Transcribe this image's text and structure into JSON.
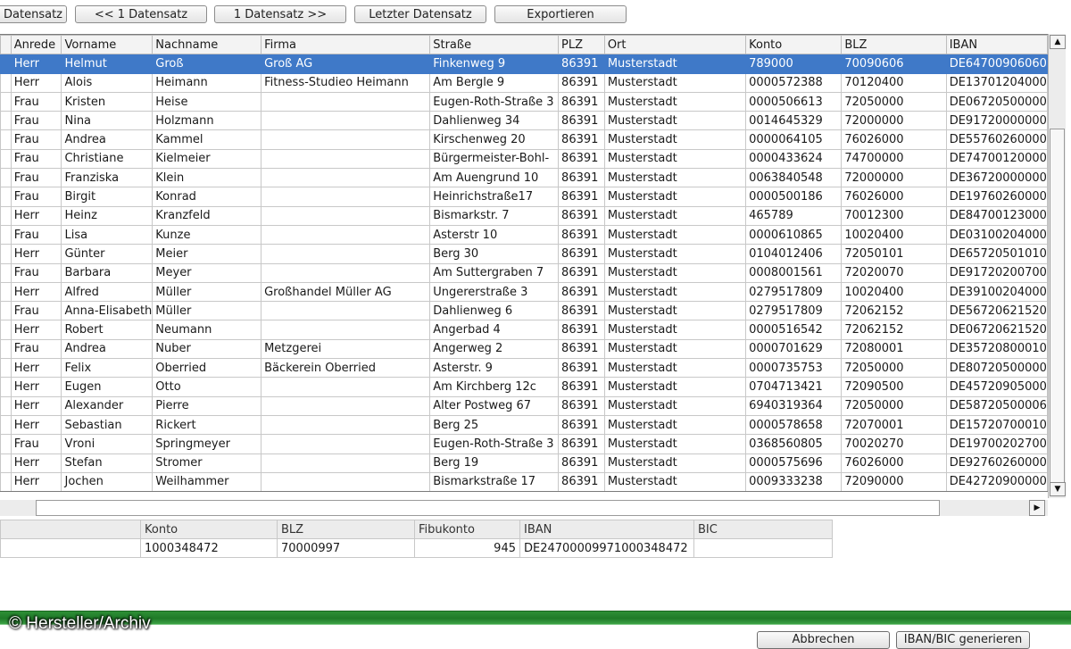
{
  "toolbar": {
    "first_record_label": "Erster Datensatz",
    "prev_record_label": "<< 1 Datensatz",
    "next_record_label": "1 Datensatz >>",
    "last_record_label": "Letzter Datensatz",
    "export_label": "Exportieren"
  },
  "grid": {
    "columns": [
      "Anrede",
      "Vorname",
      "Nachname",
      "Firma",
      "Straße",
      "PLZ",
      "Ort",
      "Konto",
      "BLZ",
      "IBAN"
    ],
    "selected_row": 0,
    "rows": [
      [
        "Herr",
        "Helmut",
        "Groß",
        "Groß AG",
        "Finkenweg 9",
        "86391",
        "Musterstadt",
        "789000",
        "70090606",
        "DE64700906060"
      ],
      [
        "Herr",
        "Alois",
        "Heimann",
        "Fitness-Studieo Heimann",
        "Am Bergle 9",
        "86391",
        "Musterstadt",
        "0000572388",
        "70120400",
        "DE13701204000"
      ],
      [
        "Frau",
        "Kristen",
        "Heise",
        "",
        "Eugen-Roth-Straße 3",
        "86391",
        "Musterstadt",
        "0000506613",
        "72050000",
        "DE06720500000"
      ],
      [
        "Frau",
        "Nina",
        "Holzmann",
        "",
        "Dahlienweg 34",
        "86391",
        "Musterstadt",
        "0014645329",
        "72000000",
        "DE91720000000"
      ],
      [
        "Frau",
        "Andrea",
        "Kammel",
        "",
        "Kirschenweg 20",
        "86391",
        "Musterstadt",
        "0000064105",
        "76026000",
        "DE55760260000"
      ],
      [
        "Frau",
        "Christiane",
        "Kielmeier",
        "",
        "Bürgermeister-Bohl-",
        "86391",
        "Musterstadt",
        "0000433624",
        "74700000",
        "DE74700120000"
      ],
      [
        "Frau",
        "Franziska",
        "Klein",
        "",
        "Am Auengrund 10",
        "86391",
        "Musterstadt",
        "0063840548",
        "72000000",
        "DE36720000000"
      ],
      [
        "Frau",
        "Birgit",
        "Konrad",
        "",
        "Heinrichstraße17",
        "86391",
        "Musterstadt",
        "0000500186",
        "76026000",
        "DE19760260000"
      ],
      [
        "Herr",
        "Heinz",
        "Kranzfeld",
        "",
        "Bismarkstr. 7",
        "86391",
        "Musterstadt",
        "465789",
        "70012300",
        "DE84700123000"
      ],
      [
        "Frau",
        "Lisa",
        "Kunze",
        "",
        "Asterstr 10",
        "86391",
        "Musterstadt",
        "0000610865",
        "10020400",
        "DE03100204000"
      ],
      [
        "Herr",
        "Günter",
        "Meier",
        "",
        "Berg 30",
        "86391",
        "Musterstadt",
        "0104012406",
        "72050101",
        "DE65720501010"
      ],
      [
        "Frau",
        "Barbara",
        "Meyer",
        "",
        "Am Suttergraben 7",
        "86391",
        "Musterstadt",
        "0008001561",
        "72020070",
        "DE91720200700"
      ],
      [
        "Herr",
        "Alfred",
        "Müller",
        "Großhandel Müller AG",
        "Ungererstraße 3",
        "86391",
        "Musterstadt",
        "0279517809",
        "10020400",
        "DE39100204000"
      ],
      [
        "Frau",
        "Anna-Elisabeth",
        "Müller",
        "",
        "Dahlienweg 6",
        "86391",
        "Musterstadt",
        "0279517809",
        "72062152",
        "DE56720621520"
      ],
      [
        "Herr",
        "Robert",
        "Neumann",
        "",
        "Angerbad 4",
        "86391",
        "Musterstadt",
        "0000516542",
        "72062152",
        "DE06720621520"
      ],
      [
        "Frau",
        "Andrea",
        "Nuber",
        "Metzgerei",
        "Angerweg 2",
        "86391",
        "Musterstadt",
        "0000701629",
        "72080001",
        "DE35720800010"
      ],
      [
        "Herr",
        "Felix",
        "Oberried",
        "Bäckerein Oberried",
        "Asterstr. 9",
        "86391",
        "Musterstadt",
        "0000735753",
        "72050000",
        "DE80720500000"
      ],
      [
        "Herr",
        "Eugen",
        "Otto",
        "",
        "Am Kirchberg 12c",
        "86391",
        "Musterstadt",
        "0704713421",
        "72090500",
        "DE45720905000"
      ],
      [
        "Herr",
        "Alexander",
        "Pierre",
        "",
        "Alter Postweg 67",
        "86391",
        "Musterstadt",
        "6940319364",
        "72050000",
        "DE58720500006"
      ],
      [
        "Herr",
        "Sebastian",
        "Rickert",
        "",
        "Berg 25",
        "86391",
        "Musterstadt",
        "0000578658",
        "72070001",
        "DE15720700010"
      ],
      [
        "Frau",
        "Vroni",
        "Springmeyer",
        "",
        "Eugen-Roth-Straße 3",
        "86391",
        "Musterstadt",
        "0368560805",
        "70020270",
        "DE19700202700"
      ],
      [
        "Herr",
        "Stefan",
        "Stromer",
        "",
        "Berg 19",
        "86391",
        "Musterstadt",
        "0000575696",
        "76026000",
        "DE92760260000"
      ],
      [
        "Herr",
        "Jochen",
        "Weilhammer",
        "",
        "Bismarkstraße 17",
        "86391",
        "Musterstadt",
        "0009333238",
        "72090000",
        "DE42720900000"
      ]
    ]
  },
  "detail": {
    "headers": {
      "konto": "Konto",
      "blz": "BLZ",
      "fibukonto": "Fibukonto",
      "iban": "IBAN",
      "bic": "BIC"
    },
    "values": {
      "konto": "1000348472",
      "blz": "70000997",
      "fibukonto": "945",
      "iban": "DE24700009971000348472",
      "bic": ""
    }
  },
  "footer": {
    "copyright": "© Hersteller/Archiv",
    "cancel_label": "Abbrechen",
    "iban_bic_label": "IBAN/BIC generieren"
  },
  "colors": {
    "selection": "#3f79c8",
    "status_bar_green": "#2e8f36"
  }
}
